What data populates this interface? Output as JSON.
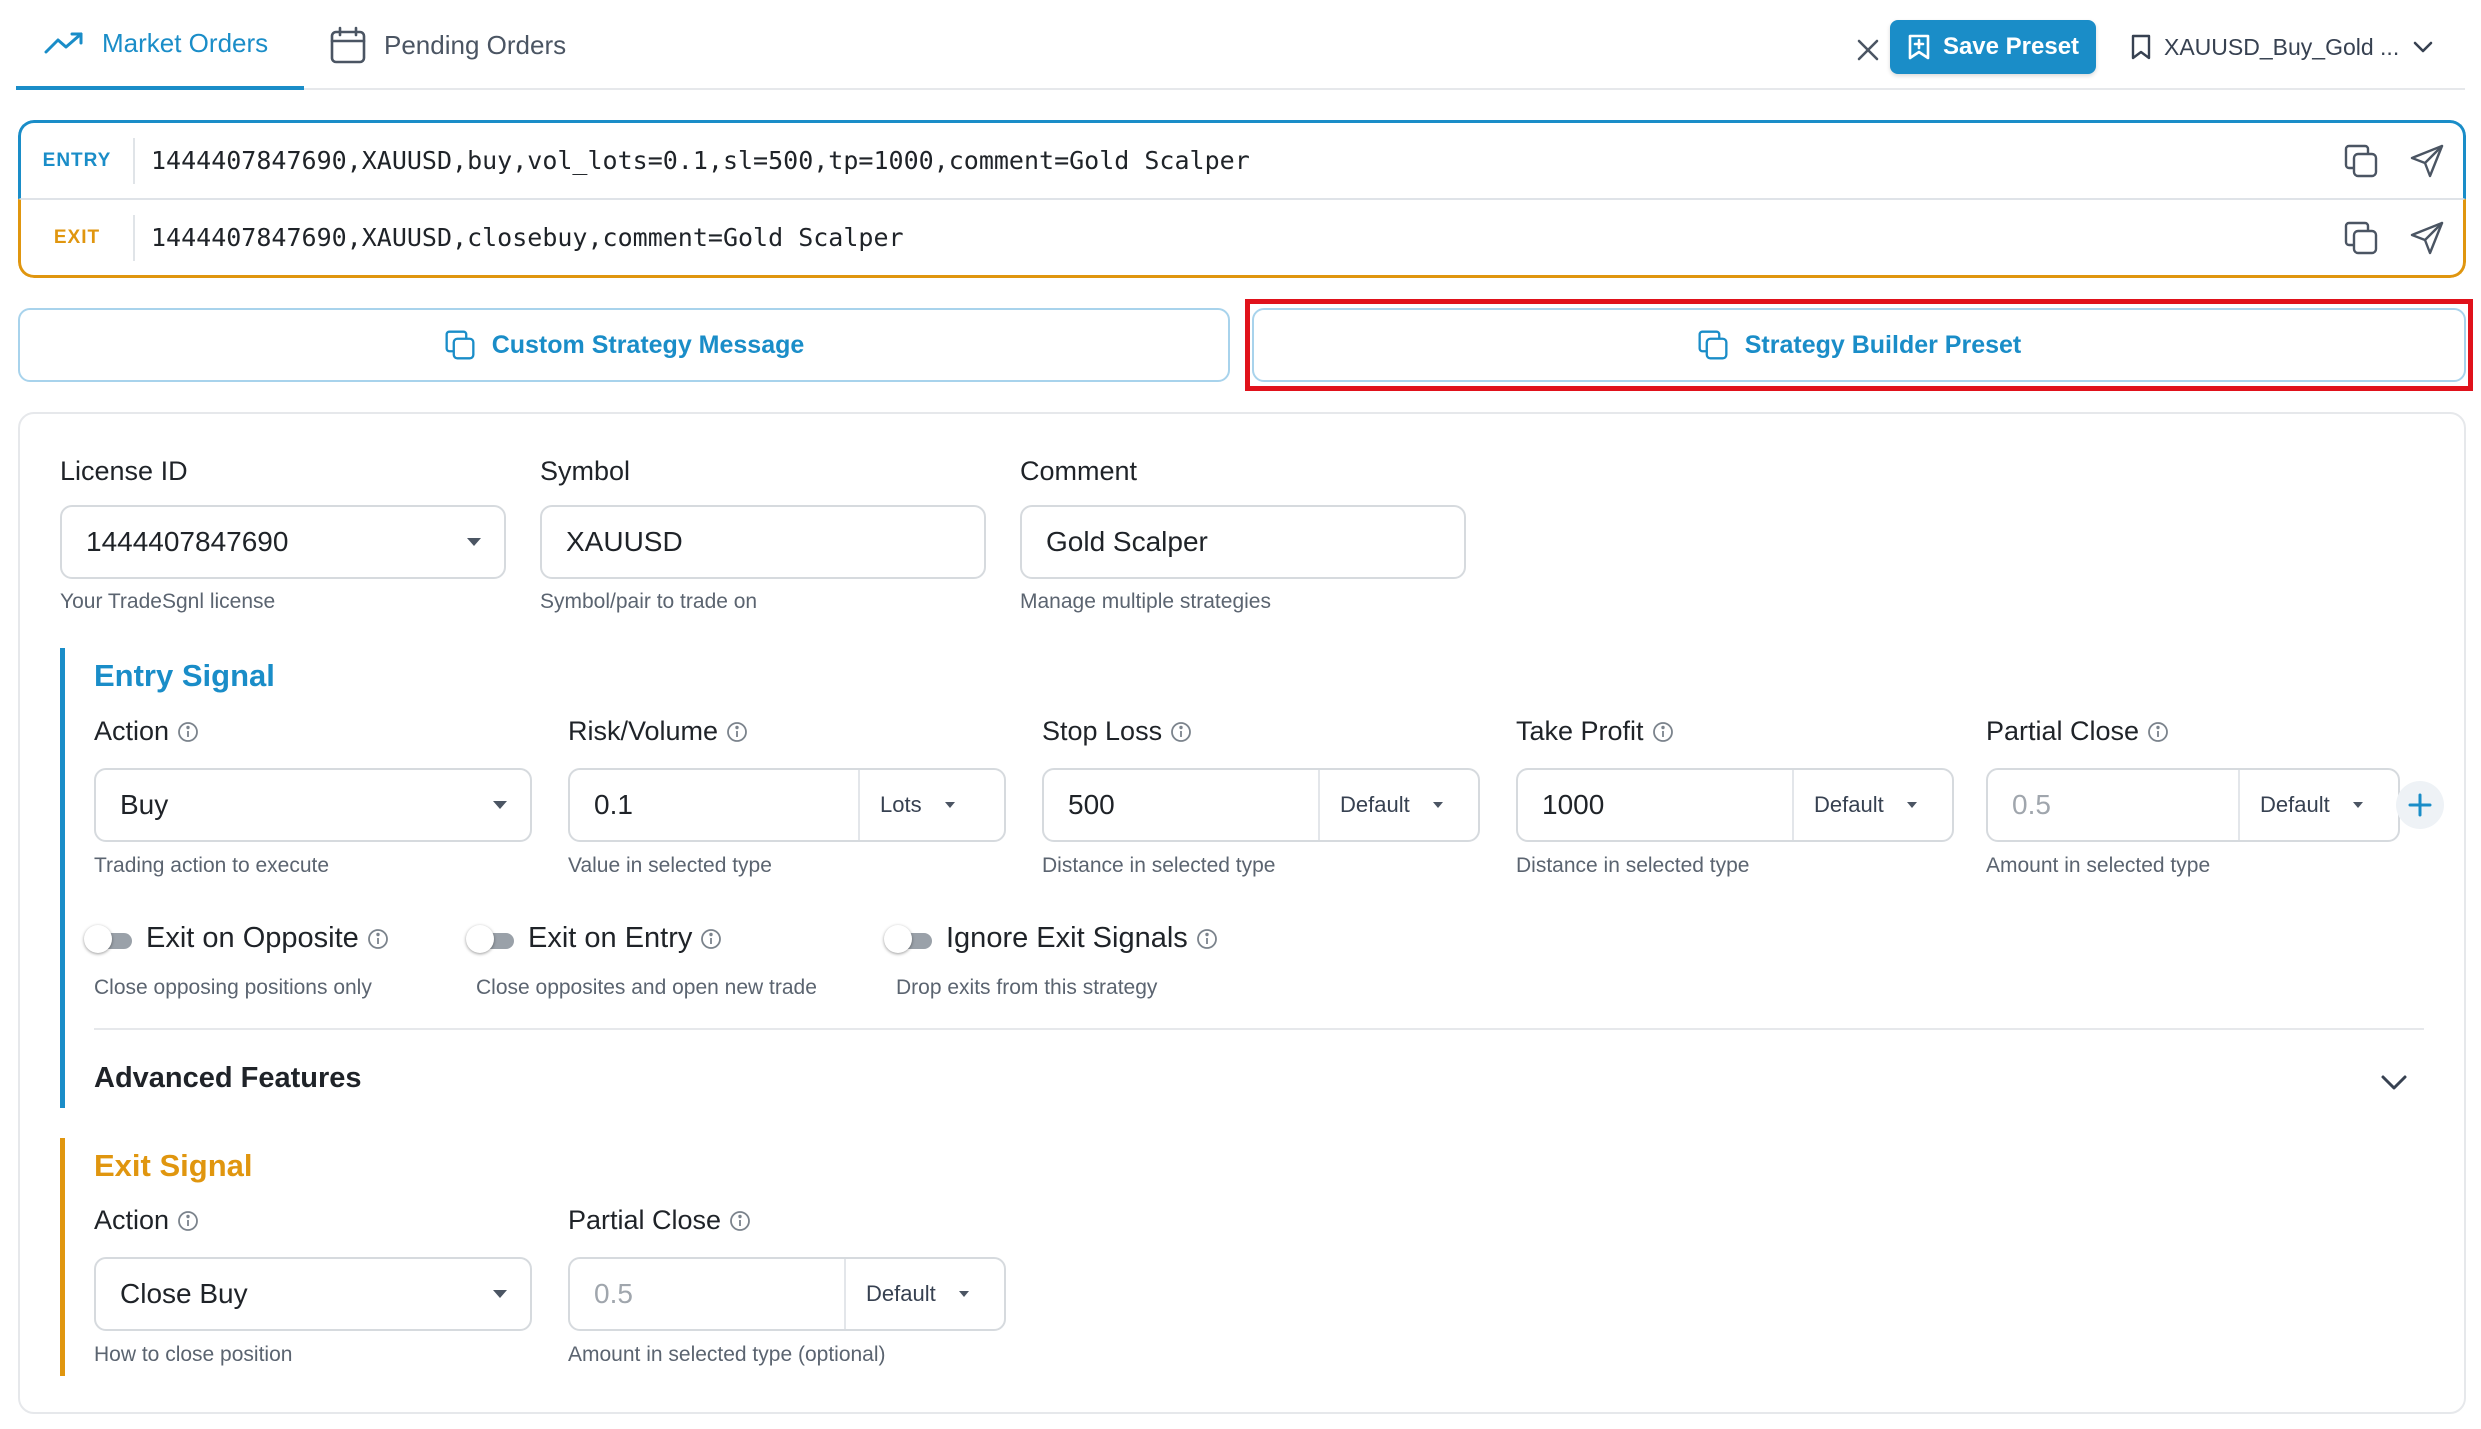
{
  "tabs": {
    "market_orders": "Market Orders",
    "pending_orders": "Pending Orders"
  },
  "toolbar": {
    "save_label": "Save Preset",
    "preset_name": "XAUUSD_Buy_Gold ..."
  },
  "messages": {
    "entry_label": "ENTRY",
    "entry_text": "1444407847690,XAUUSD,buy,vol_lots=0.1,sl=500,tp=1000,comment=Gold Scalper",
    "exit_label": "EXIT",
    "exit_text": "1444407847690,XAUUSD,closebuy,comment=Gold Scalper"
  },
  "modes": {
    "custom": "Custom Strategy Message",
    "builder": "Strategy Builder Preset"
  },
  "general": {
    "license": {
      "label": "License ID",
      "value": "1444407847690",
      "help": "Your TradeSgnl license"
    },
    "symbol": {
      "label": "Symbol",
      "value": "XAUUSD",
      "help": "Symbol/pair to trade on"
    },
    "comment": {
      "label": "Comment",
      "value": "Gold Scalper",
      "help": "Manage multiple strategies"
    }
  },
  "entry": {
    "title": "Entry Signal",
    "action": {
      "label": "Action",
      "value": "Buy",
      "help": "Trading action to execute"
    },
    "risk": {
      "label": "Risk/Volume",
      "value": "0.1",
      "unit": "Lots",
      "help": "Value in selected type"
    },
    "stop_loss": {
      "label": "Stop Loss",
      "value": "500",
      "unit": "Default",
      "help": "Distance in selected type"
    },
    "take_profit": {
      "label": "Take Profit",
      "value": "1000",
      "unit": "Default",
      "help": "Distance in selected type"
    },
    "partial_close": {
      "label": "Partial Close",
      "placeholder": "0.5",
      "unit": "Default",
      "help": "Amount in selected type"
    },
    "toggles": [
      {
        "label": "Exit on Opposite",
        "help": "Close opposing positions only"
      },
      {
        "label": "Exit on Entry",
        "help": "Close opposites and open new trade"
      },
      {
        "label": "Ignore Exit Signals",
        "help": "Drop exits from this strategy"
      }
    ],
    "advanced": "Advanced Features"
  },
  "exit": {
    "title": "Exit Signal",
    "action": {
      "label": "Action",
      "value": "Close Buy",
      "help": "How to close position"
    },
    "partial_close": {
      "label": "Partial Close",
      "placeholder": "0.5",
      "unit": "Default",
      "help": "Amount in selected type (optional)"
    }
  },
  "colors": {
    "accent": "#1a8dc8",
    "exit_accent": "#e0960f",
    "highlight": "#e0121b"
  }
}
